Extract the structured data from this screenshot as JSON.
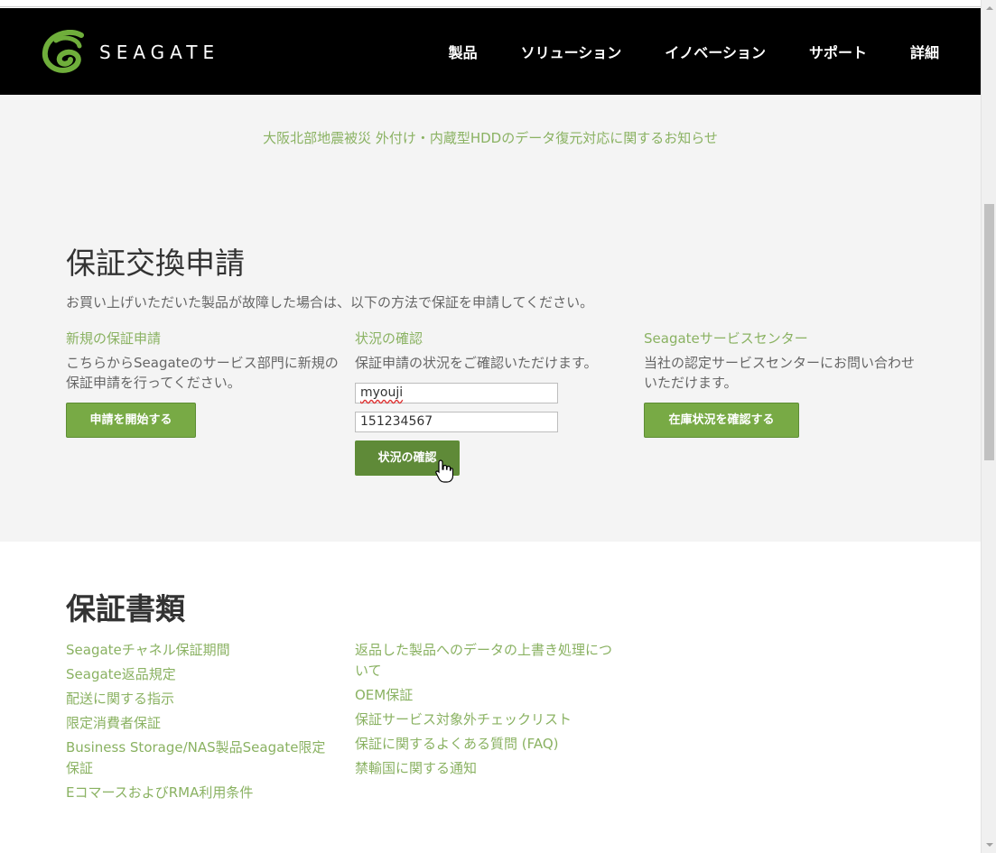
{
  "header": {
    "logo_text": "SEAGATE",
    "nav": [
      "製品",
      "ソリューション",
      "イノベーション",
      "サポート",
      "詳細"
    ]
  },
  "notice": "大阪北部地震被災 外付け・内蔵型HDDのデータ復元対応に関するお知らせ",
  "warranty": {
    "title": "保証交換申請",
    "intro": "お買い上げいただいた製品が故障した場合は、以下の方法で保証を申請してください。",
    "new_claim": {
      "heading": "新規の保証申請",
      "text": "こちらからSeagateのサービス部門に新規の保証申請を行ってください。",
      "button": "申請を開始する"
    },
    "status": {
      "heading": "状況の確認",
      "text": "保証申請の状況をご確認いただけます。",
      "field_name": "myouji",
      "field_number": "151234567",
      "button": "状況の確認"
    },
    "service_center": {
      "heading": "Seagateサービスセンター",
      "text": "当社の認定サービスセンターにお問い合わせいただけます。",
      "button": "在庫状況を確認する"
    }
  },
  "documents": {
    "title": "保証書類",
    "col1": [
      "Seagateチャネル保証期間",
      "Seagate返品規定",
      "配送に関する指示",
      "限定消費者保証",
      "Business Storage/NAS製品Seagate限定保証",
      "EコマースおよびRMA利用条件"
    ],
    "col2": [
      "返品した製品へのデータの上書き処理について",
      "OEM保証",
      "保証サービス対象外チェックリスト",
      "保証に関するよくある質問 (FAQ)",
      "禁輸国に関する通知"
    ]
  },
  "colors": {
    "accent_green": "#8ab262",
    "button_green": "#78aa45",
    "header_bg": "#000000",
    "band_bg": "#f4f4f4"
  }
}
